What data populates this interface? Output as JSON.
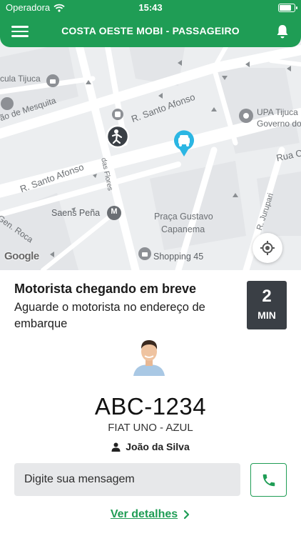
{
  "status_bar": {
    "carrier": "Operadora",
    "time": "15:43",
    "battery_level": 0.85
  },
  "app_bar": {
    "title": "COSTA OESTE MOBI - PASSAGEIRO",
    "menu_icon": "hamburger-icon",
    "notification_icon": "bell-icon"
  },
  "map": {
    "labels": {
      "tijuca_left": "cula Tijuca",
      "mesquita": "rão de Mesquita",
      "santo_afonso_top": "R. Santo Afonso",
      "santo_afonso_left": "R. Santo Afonso",
      "das_flores": "das Flores",
      "saens_pena": "Saens Peña",
      "praca_line1": "Praça Gustavo",
      "praca_line2": "Capanema",
      "gen_roca": "Gen. Roca",
      "upa_line1": "UPA Tijuca",
      "upa_line2": "Governo do",
      "rua_c": "Rua C",
      "jurupari": "R. Jurupari",
      "shopping": "Shopping 45"
    },
    "metro_badge": "M",
    "google_logo": "Google",
    "locate_icon": "crosshair-icon"
  },
  "trip": {
    "headline": "Motorista chegando em breve",
    "subline": "Aguarde o motorista no endereço de embarque",
    "eta_value": "2",
    "eta_unit": "MIN",
    "plate": "ABC-1234",
    "vehicle": "FIAT UNO - AZUL",
    "driver_name": "João da Silva"
  },
  "message": {
    "placeholder": "Digite sua mensagem"
  },
  "details_link": "Ver detalhes",
  "colors": {
    "brand_green": "#1f9d55",
    "eta_box": "#3a3f45",
    "car_marker": "#2bb6e3",
    "map_background": "#eceef0"
  }
}
